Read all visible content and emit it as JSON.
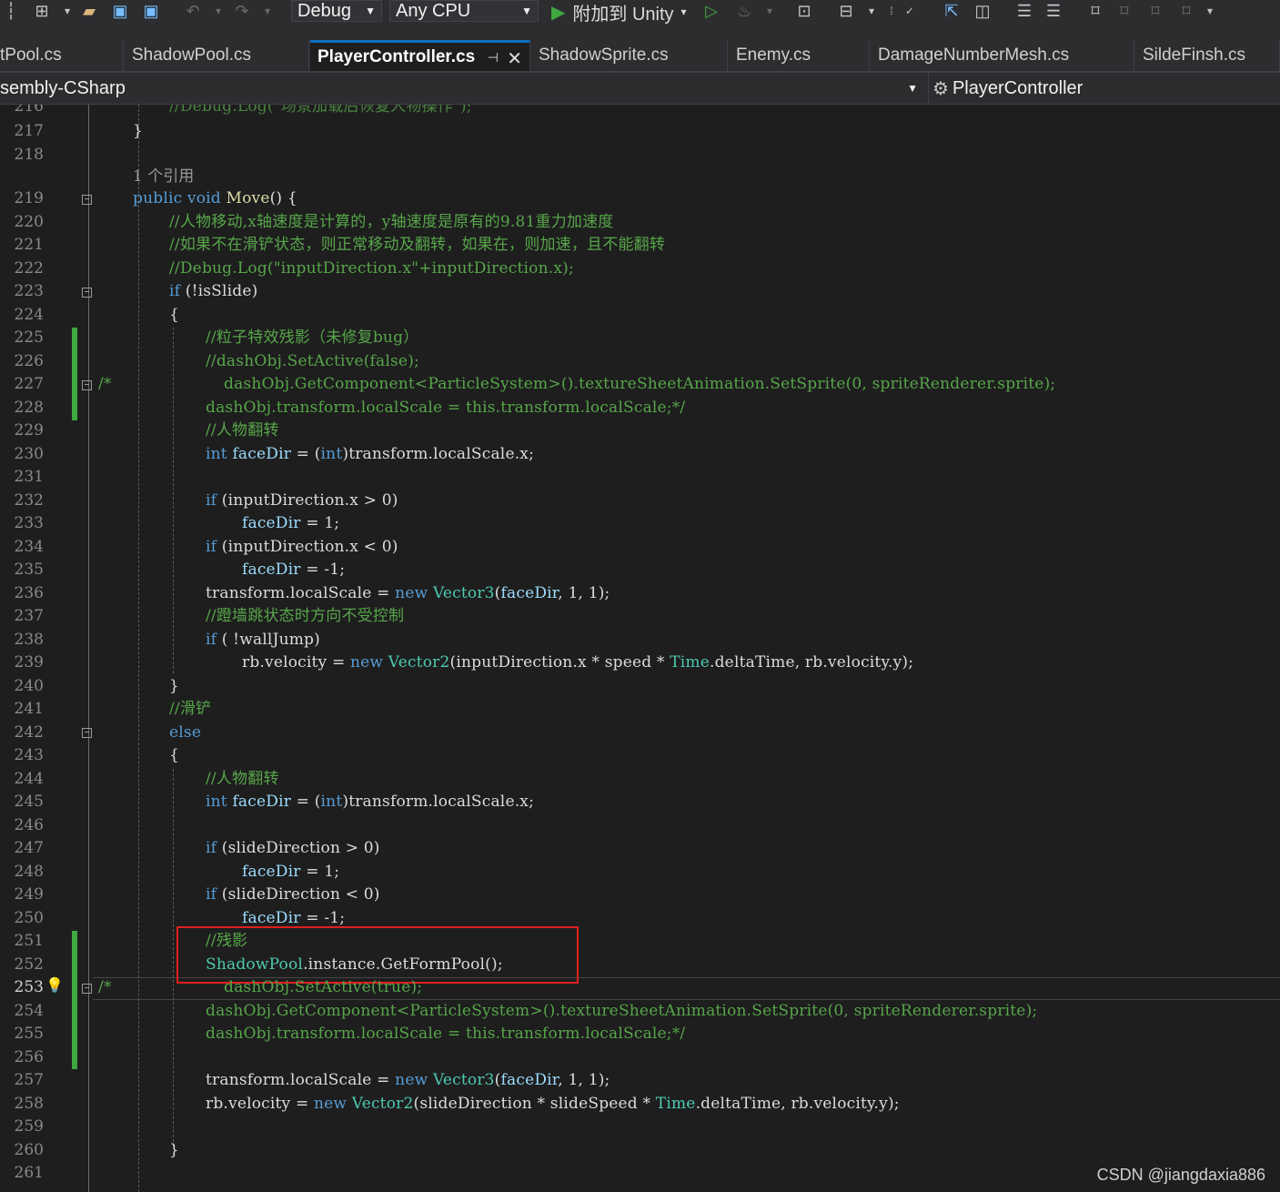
{
  "toolbar": {
    "config": "Debug",
    "platform": "Any CPU",
    "attach": "附加到 Unity"
  },
  "tabs": [
    "tPool.cs",
    "ShadowPool.cs",
    "PlayerController.cs",
    "ShadowSprite.cs",
    "Enemy.cs",
    "DamageNumberMesh.cs",
    "SildeFinsh.cs"
  ],
  "navbar": {
    "project": "sembly-CSharp",
    "class": "PlayerController"
  },
  "code": {
    "ref_count": "1 个引用",
    "line_numbers": [
      "216",
      "217",
      "218",
      "219",
      "220",
      "221",
      "222",
      "223",
      "224",
      "225",
      "226",
      "227",
      "228",
      "229",
      "230",
      "231",
      "232",
      "233",
      "234",
      "235",
      "236",
      "237",
      "238",
      "239",
      "240",
      "241",
      "242",
      "243",
      "244",
      "245",
      "246",
      "247",
      "248",
      "249",
      "250",
      "251",
      "252",
      "253",
      "254",
      "255",
      "256",
      "257",
      "258",
      "259",
      "260",
      "261"
    ],
    "lines": {
      "l216": "//Debug.Log(\"场景加载后恢复人物操作\");",
      "l217": "}",
      "l219_kw": "public void ",
      "l219_fn": "Move",
      "l219_end": "() {",
      "l220": "//人物移动,x轴速度是计算的，y轴速度是原有的9.81重力加速度",
      "l221": "//如果不在滑铲状态，则正常移动及翻转，如果在，则加速，且不能翻转",
      "l222": "//Debug.Log(\"inputDirection.x\"+inputDirection.x);",
      "l223_kw": "if",
      "l223_rest": " (!isSlide)",
      "brace_open": "{",
      "brace_close": "}",
      "l225": "//粒子特效残影（未修复bug）",
      "l226": "//dashObj.SetActive(false);",
      "l227_start": "/*",
      "l227": "dashObj.GetComponent<ParticleSystem>().textureSheetAnimation.SetSprite(0, spriteRenderer.sprite);",
      "l228": "dashObj.transform.localScale = this.transform.localScale;*/",
      "l229": "//人物翻转",
      "int_kw": "int",
      "faceDir_decl_rest": " = (",
      "faceDir_cast_rest": ")transform.localScale.x;",
      "faceDir": "faceDir",
      "l232_rest": " (inputDirection.x > 0)",
      "assign_pos": " = 1;",
      "l234_rest": " (inputDirection.x < 0)",
      "assign_neg": " = -1;",
      "l236_a": "transform.localScale = ",
      "new_kw": "new",
      "vector3": "Vector3",
      "l236_b": "(",
      "l236_c": ", 1, 1);",
      "l237": "//蹬墙跳状态时方向不受控制",
      "l238_rest": " ( !wallJump)",
      "l239_a": "rb.velocity = ",
      "vector2": "Vector2",
      "l239_b": "(inputDirection.x * speed * ",
      "time": "Time",
      "l239_c": ".deltaTime, rb.velocity.y);",
      "l241": "//滑铲",
      "else_kw": "else",
      "l244": "//人物翻转",
      "l247_rest": " (slideDirection > 0)",
      "l249_rest": " (slideDirection < 0)",
      "l251": "//残影",
      "shadowpool": "ShadowPool",
      "l252_rest": ".instance.GetFormPool();",
      "l253_start": "/*",
      "l253": "dashObj.SetActive(true);",
      "l254": "dashObj.GetComponent<ParticleSystem>().textureSheetAnimation.SetSprite(0, spriteRenderer.sprite);",
      "l255": "dashObj.transform.localScale = this.transform.localScale;*/",
      "l258_a": "rb.velocity = ",
      "l258_b": "(slideDirection * slideSpeed * ",
      "l258_c": ".deltaTime, rb.velocity.y);"
    }
  },
  "watermark": "CSDN @jiangdaxia886",
  "colors": {
    "keyword": "#569cd6",
    "comment": "#57a64a",
    "type": "#4ec9b0",
    "identifier": "#9cdcfe",
    "highlight_box": "#e02020",
    "change_bar": "#3fa93f"
  }
}
